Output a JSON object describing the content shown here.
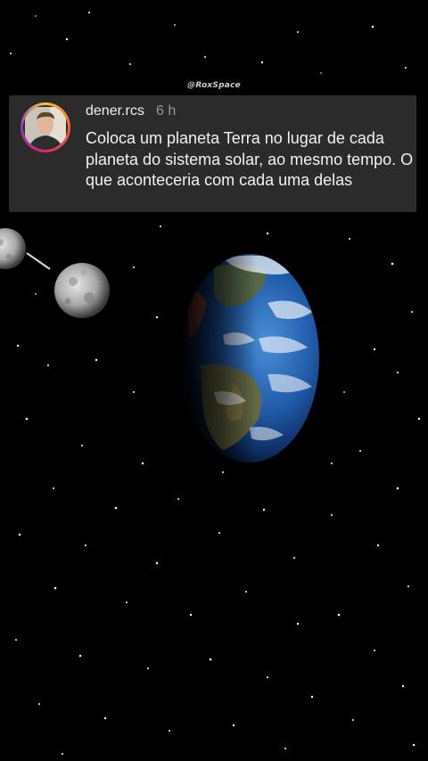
{
  "watermark": "@RoxSpace",
  "comment": {
    "username": "dener.rcs",
    "time": "6 h",
    "text": "Coloca um planeta Terra no lugar de cada planeta do sistema solar, ao mesmo tempo. O que aconteceria com cada uma delas"
  },
  "colors": {
    "background": "#000000",
    "card": "#2b2b2b",
    "text": "#f2f2f2",
    "muted": "#9a9a9a"
  }
}
